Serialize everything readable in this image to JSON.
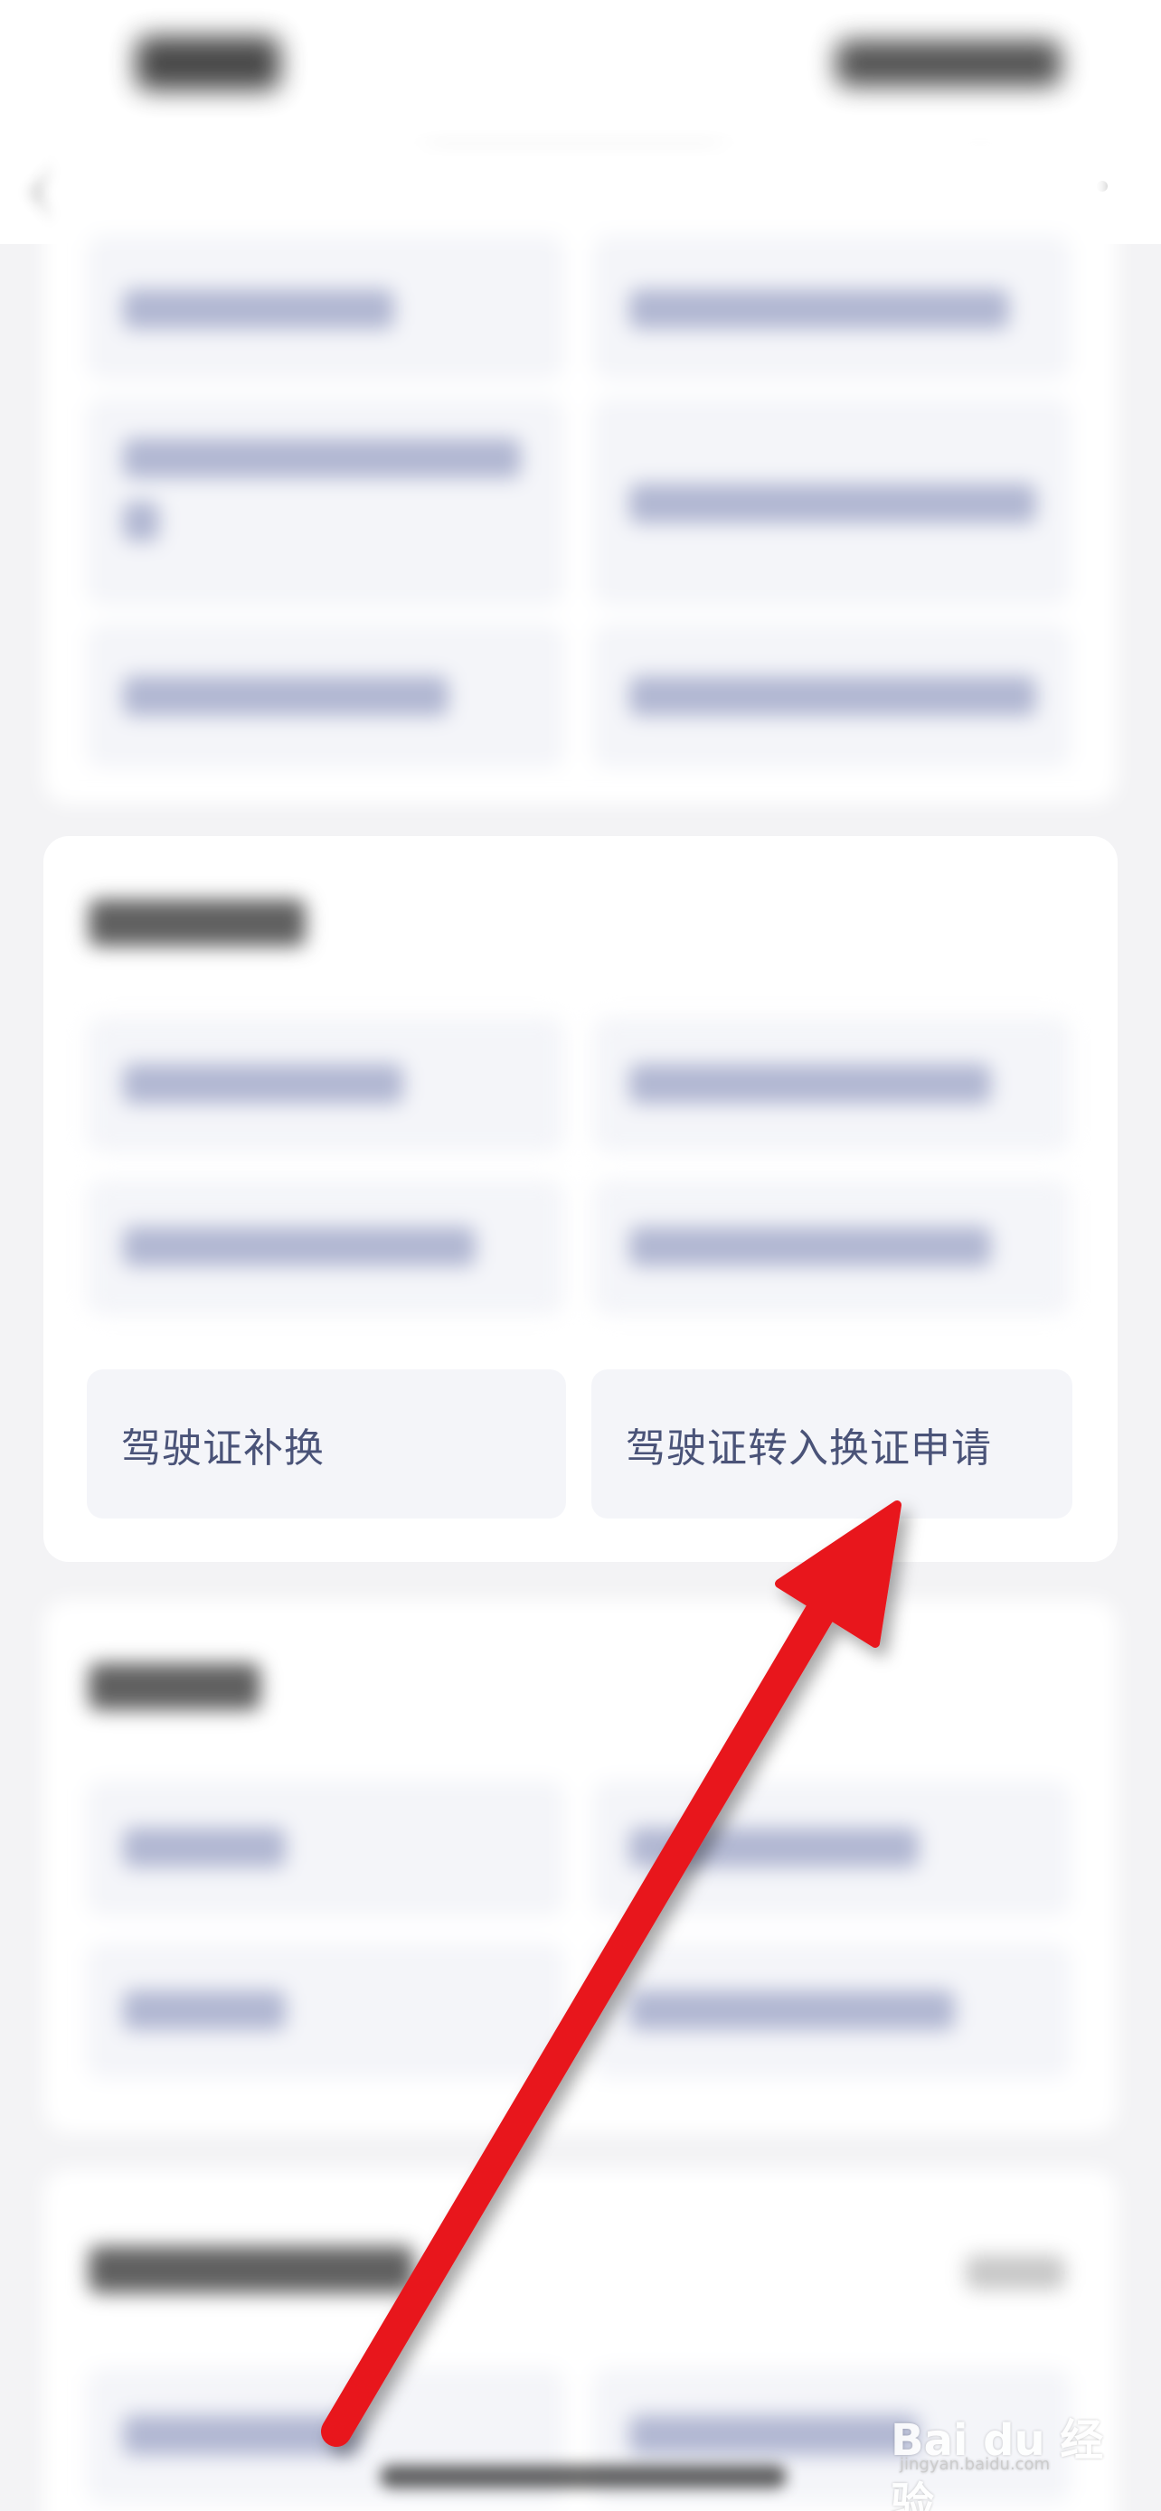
{
  "focused_service_row": {
    "left_item_label": "驾驶证补换",
    "right_item_label": "驾驶证转入换证申请"
  },
  "annotation": {
    "type": "red-arrow",
    "color": "#e8151b",
    "points_to": "right_item"
  },
  "watermark": {
    "text": "Bai du 经验",
    "sub_text": "jingyan.baidu.com"
  }
}
